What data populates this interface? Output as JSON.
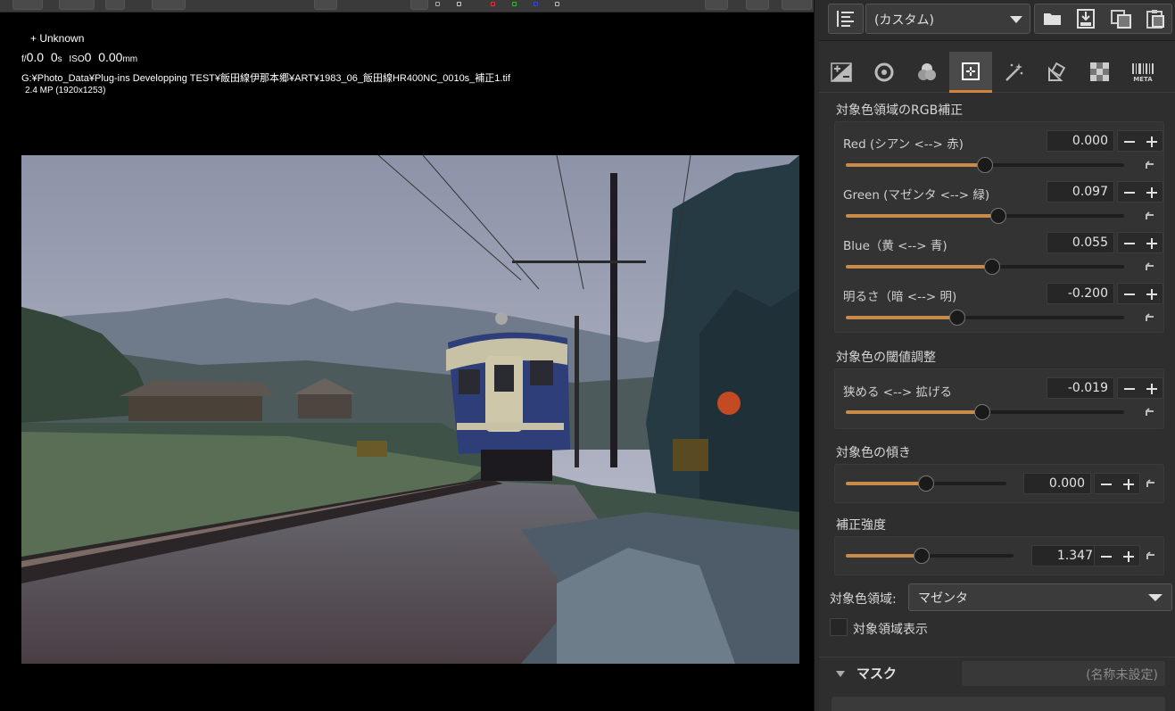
{
  "viewer": {
    "camera": "+ Unknown",
    "exif_f": "0.0",
    "exif_s": "0",
    "exif_iso": "0",
    "exif_mm": "0.00",
    "path": "G:¥Photo_Data¥Plug-ins Developping TEST¥飯田線伊那本郷¥ART¥1983_06_飯田線HR400NC_0010s_補正1.tif",
    "size": "2.4 MP (1920x1253)"
  },
  "toolbar": {
    "preset": "(カスタム)"
  },
  "tabs": [
    "exposure-icon",
    "tone-icon",
    "color-icon",
    "point-color-icon",
    "retouch-icon",
    "lens-icon",
    "noise-icon",
    "meta-icon"
  ],
  "rgb": {
    "title": "対象色領域のRGB補正",
    "sliders": [
      {
        "label": "Red (シアン <--> 赤)",
        "value": "0.000",
        "level": 0.5
      },
      {
        "label": "Green (マゼンタ <--> 緑)",
        "value": "0.097",
        "level": 0.548
      },
      {
        "label": "Blue（黄 <--> 青)",
        "value": "0.055",
        "level": 0.527
      },
      {
        "label": "明るさ（暗 <--> 明)",
        "value": "-0.200",
        "level": 0.4
      }
    ]
  },
  "threshold": {
    "title": "対象色の閾値調整",
    "label": "狭める <--> 拡げる",
    "value": "-0.019",
    "level": 0.49
  },
  "slope": {
    "title": "対象色の傾き",
    "value": "0.000",
    "level": 0.5
  },
  "strength": {
    "title": "補正強度",
    "value": "1.347",
    "level": 0.45
  },
  "target": {
    "label": "対象色領域:",
    "value": "マゼンタ"
  },
  "show_area": {
    "label": "対象領域表示"
  },
  "mask": {
    "title": "マスク",
    "name_placeholder": "(名称未設定)"
  }
}
